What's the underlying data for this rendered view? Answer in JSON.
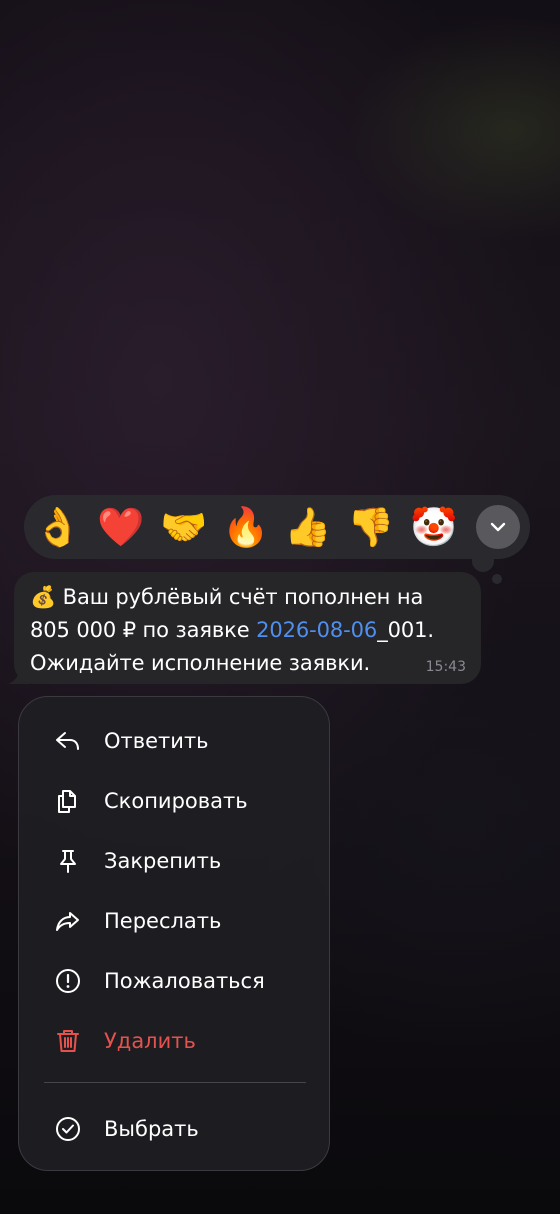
{
  "reactions": [
    {
      "emoji": "👌",
      "name": "ok-hand-icon"
    },
    {
      "emoji": "❤️",
      "name": "heart-icon"
    },
    {
      "emoji": "🤝",
      "name": "handshake-icon"
    },
    {
      "emoji": "🔥",
      "name": "fire-icon"
    },
    {
      "emoji": "👍",
      "name": "thumbs-up-icon"
    },
    {
      "emoji": "👎",
      "name": "thumbs-down-icon"
    },
    {
      "emoji": "🤡",
      "name": "clown-icon"
    }
  ],
  "reactions_more_icon": "chevron-down-icon",
  "message": {
    "emoji": "💰",
    "line1": " Ваш рублёвый счёт пополнен на",
    "line2_prefix": "805 000 ₽ по заявке ",
    "link": "2026-08-06",
    "line2_suffix": "_001.",
    "line3": "Ожидайте исполнение заявки.",
    "time": "15:43"
  },
  "menu": {
    "items": [
      {
        "label": "Ответить",
        "icon": "reply-icon"
      },
      {
        "label": "Скопировать",
        "icon": "copy-icon"
      },
      {
        "label": "Закрепить",
        "icon": "pin-icon"
      },
      {
        "label": "Переслать",
        "icon": "forward-icon"
      },
      {
        "label": "Пожаловаться",
        "icon": "report-icon"
      },
      {
        "label": "Удалить",
        "icon": "trash-icon"
      },
      {
        "label": "Выбрать",
        "icon": "select-check-icon"
      }
    ]
  },
  "colors": {
    "link": "#4f8ff0",
    "danger": "#e5524d",
    "bubble": "#262528",
    "menu": "#1e1e22"
  }
}
